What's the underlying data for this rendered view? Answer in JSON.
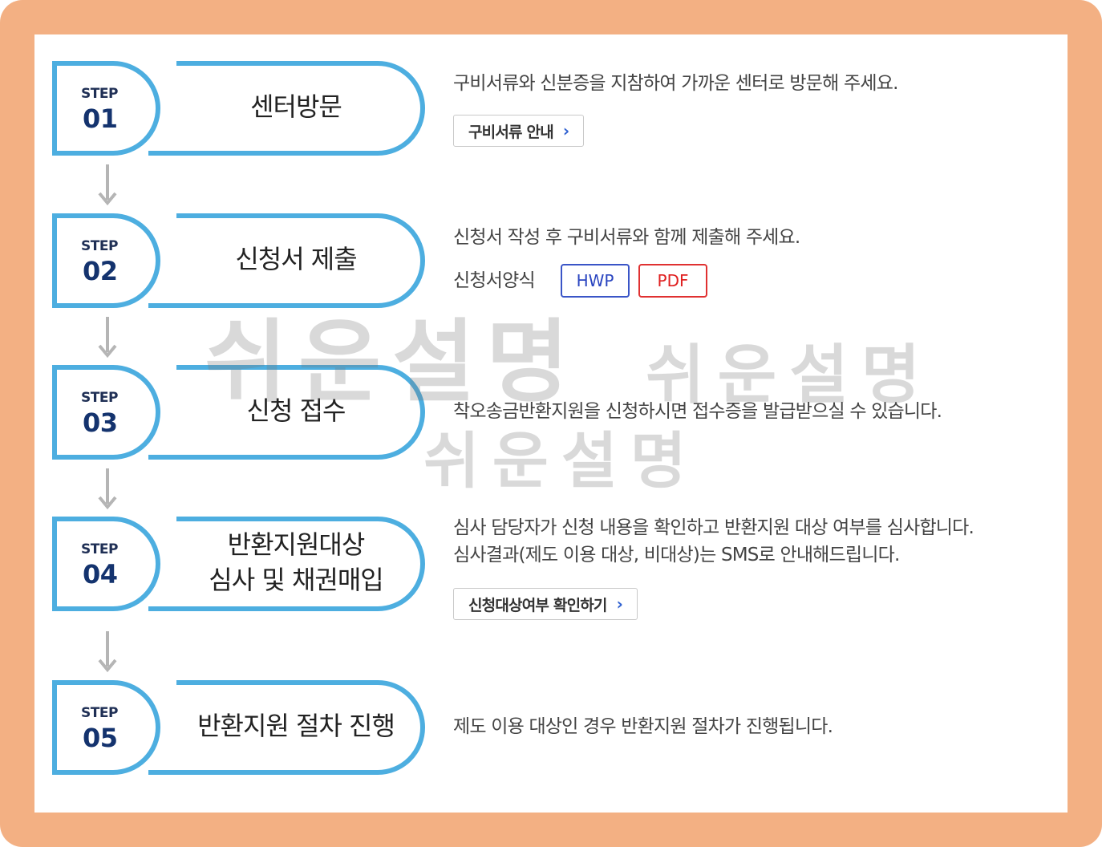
{
  "step_word": "STEP",
  "steps": [
    {
      "num": "01",
      "title": "센터방문",
      "desc": "구비서류와 신분증을 지참하여 가까운 센터로 방문해 주세요.",
      "button": "구비서류 안내"
    },
    {
      "num": "02",
      "title": "신청서 제출",
      "desc": "신청서 작성 후 구비서류와 함께 제출해 주세요.",
      "form_label": "신청서양식",
      "hwp": "HWP",
      "pdf": "PDF"
    },
    {
      "num": "03",
      "title": "신청 접수",
      "desc": "착오송금반환지원을 신청하시면 접수증을 발급받으실 수 있습니다."
    },
    {
      "num": "04",
      "title_line1": "반환지원대상",
      "title_line2": "심사 및 채권매입",
      "desc_line1": "심사 담당자가 신청 내용을 확인하고 반환지원 대상 여부를 심사합니다.",
      "desc_line2": "심사결과(제도 이용 대상, 비대상)는 SMS로 안내해드립니다.",
      "button": "신청대상여부 확인하기"
    },
    {
      "num": "05",
      "title": "반환지원 절차 진행",
      "desc": "제도 이용 대상인 경우 반환지원 절차가 진행됩니다."
    }
  ],
  "chevron": "›",
  "watermark": "쉬운설명",
  "colors": {
    "frame": "#f3b083",
    "badge_blue": "#4daee0",
    "step_navy": "#14336e",
    "hwp": "#2a45c0",
    "pdf": "#e02020"
  }
}
